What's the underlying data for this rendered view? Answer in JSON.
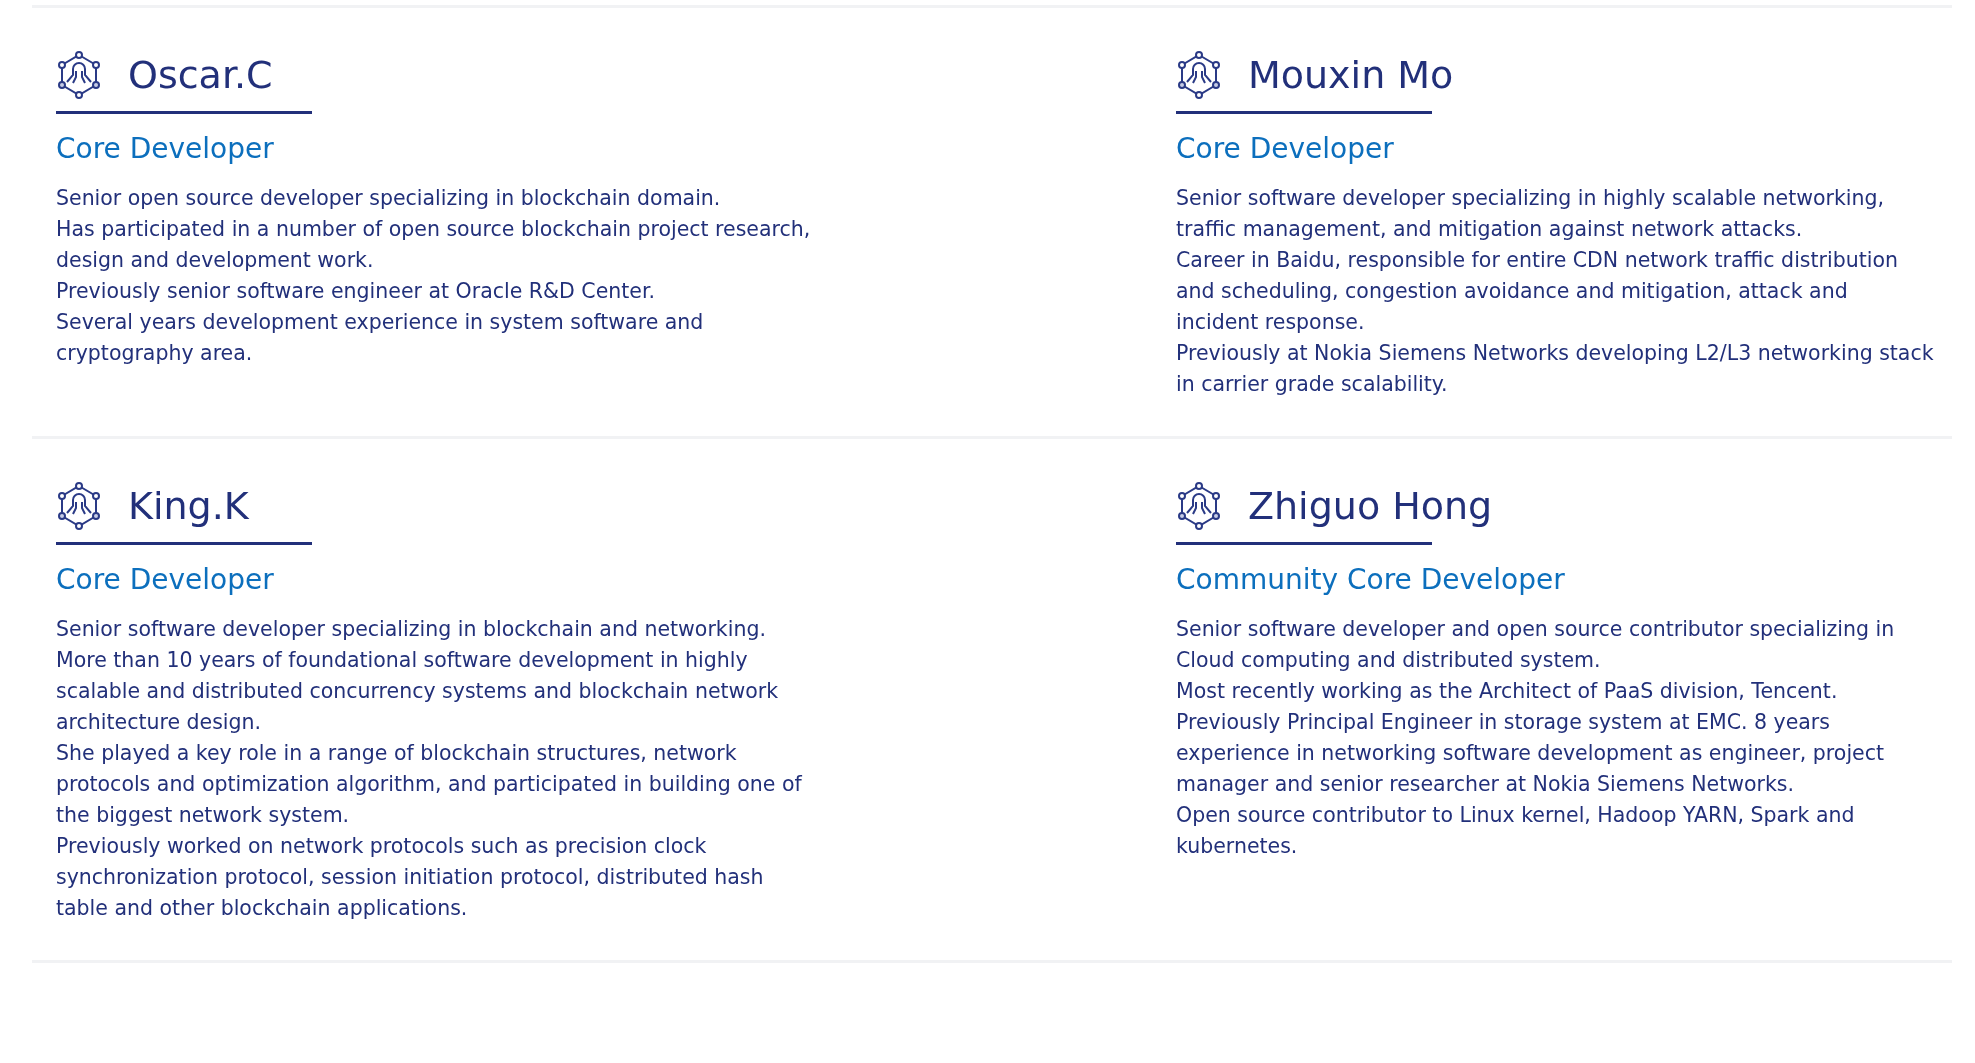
{
  "members": [
    {
      "name": "Oscar.C",
      "role": "Core Developer",
      "bio": [
        "Senior open source developer specializing in blockchain domain.",
        "Has participated in a number of open source blockchain project research, design and development work.",
        "Previously senior software engineer at Oracle R&D Center.",
        "Several years development experience in system software and cryptography area."
      ]
    },
    {
      "name": "Mouxin Mo",
      "role": "Core Developer",
      "bio": [
        "Senior software developer specializing in highly scalable networking, traffic management, and mitigation against network attacks.",
        "Career in Baidu, responsible for entire CDN network traffic distribution and scheduling, congestion avoidance and mitigation, attack and incident response.",
        "Previously at Nokia Siemens Networks developing L2/L3 networking stack in carrier grade scalability."
      ]
    },
    {
      "name": "King.K",
      "role": "Core Developer",
      "bio": [
        "Senior software developer specializing in blockchain and networking.",
        "More than 10 years of foundational software development in highly scalable and distributed concurrency systems and blockchain network architecture design.",
        "She played a key role in a range of blockchain structures, network protocols and optimization algorithm, and participated in building one of the biggest network system.",
        "Previously worked on network protocols such as precision clock synchronization protocol, session initiation protocol, distributed hash table and other blockchain applications."
      ]
    },
    {
      "name": "Zhiguo Hong",
      "role": "Community Core Developer",
      "bio": [
        "Senior software developer and open source contributor specializing in Cloud computing and distributed system.",
        "Most recently working as the Architect of PaaS division, Tencent.",
        "Previously Principal Engineer in storage system at EMC. 8 years experience in networking software development as engineer, project manager and senior researcher at Nokia Siemens Networks.",
        "Open source contributor to Linux kernel, Hadoop YARN, Spark and kubernetes."
      ]
    }
  ]
}
